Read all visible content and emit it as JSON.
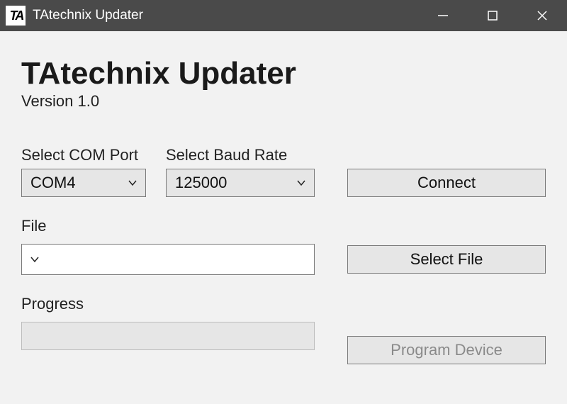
{
  "window": {
    "title": "TAtechnix Updater",
    "icon_text": "TA"
  },
  "header": {
    "title": "TAtechnix Updater",
    "version": "Version 1.0"
  },
  "com": {
    "label": "Select COM Port",
    "value": "COM4"
  },
  "baud": {
    "label": "Select Baud Rate",
    "value": "125000"
  },
  "buttons": {
    "connect": "Connect",
    "select_file": "Select File",
    "program_device": "Program Device"
  },
  "file": {
    "label": "File",
    "value": ""
  },
  "progress": {
    "label": "Progress"
  }
}
